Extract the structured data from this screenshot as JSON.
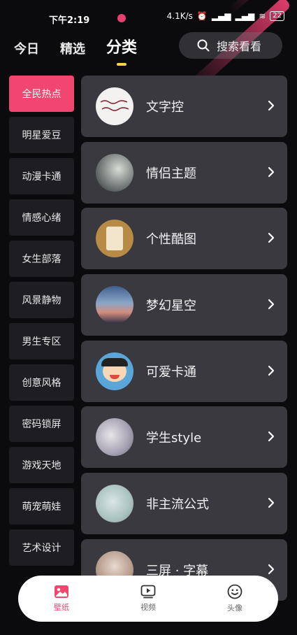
{
  "status_bar": {
    "time": "下午2:19",
    "net_speed": "4.1K/s",
    "battery": "22"
  },
  "top_tabs": [
    {
      "label": "今日"
    },
    {
      "label": "精选"
    },
    {
      "label": "分类"
    }
  ],
  "search": {
    "label": "搜索看看"
  },
  "sidebar": {
    "items": [
      {
        "label": "全民热点"
      },
      {
        "label": "明星爱豆"
      },
      {
        "label": "动漫卡通"
      },
      {
        "label": "情感心绪"
      },
      {
        "label": "女生部落"
      },
      {
        "label": "风景静物"
      },
      {
        "label": "男生专区"
      },
      {
        "label": "创意风格"
      },
      {
        "label": "密码锁屏"
      },
      {
        "label": "游戏天地"
      },
      {
        "label": "萌宠萌娃"
      },
      {
        "label": "艺术设计"
      }
    ]
  },
  "categories": [
    {
      "label": "文字控"
    },
    {
      "label": "情侣主题"
    },
    {
      "label": "个性酷图"
    },
    {
      "label": "梦幻星空"
    },
    {
      "label": "可爱卡通"
    },
    {
      "label": "学生style"
    },
    {
      "label": "非主流公式"
    },
    {
      "label": "三屏 · 字幕"
    }
  ],
  "bottom_nav": [
    {
      "label": "壁纸",
      "icon": "wallpaper-icon"
    },
    {
      "label": "视频",
      "icon": "video-icon"
    },
    {
      "label": "头像",
      "icon": "smiley-icon"
    }
  ],
  "colors": {
    "accent": "#f0466f",
    "tab_indicator": "#f5d44a",
    "card_bg": "#3a393f",
    "sidebar_bg": "#1e1e22"
  }
}
